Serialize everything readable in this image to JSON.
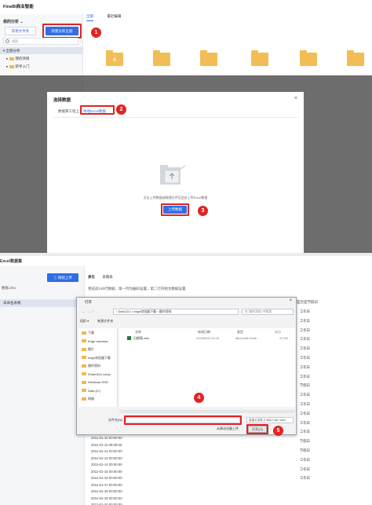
{
  "top": {
    "app_title": "FineBI商业智能",
    "my_analysis": "我的分析",
    "new_folder_label": "新建文件夹",
    "new_theme_label": "新建分析主题",
    "search_placeholder": "搜索",
    "tree": [
      "全部分析",
      "我的项目",
      "新手入门"
    ],
    "tabs": [
      "全部",
      "最近编辑"
    ],
    "folders": [
      "",
      "",
      "",
      "",
      "",
      "",
      "",
      ""
    ],
    "badges": [
      "1",
      "2",
      "3",
      "4",
      "5"
    ]
  },
  "dialog": {
    "title": "选择数据",
    "close": "×",
    "tab_server": "数据库工程上",
    "tab_excel": "本地Excel数据",
    "upload_text": "点击上传数据或拖拽文件至此处上传Excel数据",
    "upload_button": "上传数据"
  },
  "bottom": {
    "title": "Excel数据集",
    "continue_upload": "继续上传",
    "file_sheet": "数据.xlsx",
    "unnamed": "未命名表格",
    "table_tabs": [
      "表名",
      "日期表"
    ],
    "hint": "预览前100行数据，第一列为编码设置，第二行开始为数据设置",
    "right_header": "是否是节假日",
    "rows": [
      "2011-01-10 00:00:00",
      "2011-01-11 00:00:00",
      "2011-01-12 00:00:00",
      "2011-01-13 00:00:00",
      "2011-01-14 00:00:00",
      "2011-01-15 00:00:00",
      "2011-01-16 00:00:00",
      "2011-01-17 00:00:00",
      "2011-01-18 00:00:00",
      "2011-01-19 00:00:00",
      "2011-01-20 00:00:00"
    ],
    "right_vals": [
      "工作日",
      "工作日",
      "工作日",
      "工作日",
      "工作日",
      "工作日",
      "工作日",
      "工作日",
      "节假日",
      "工作日",
      "工作日",
      "工作日",
      "工作日",
      "工作日",
      "节假日",
      "节假日",
      "工作日",
      "工作日",
      "工作日"
    ]
  },
  "file_dialog": {
    "title": "打开",
    "close": "×",
    "nav": "←  →  ↑",
    "address": "› Data (D:) › edge浏览器下载 › 操作资料",
    "search": "在 操作资料 中搜索",
    "toolbar_org": "组织 ▾",
    "toolbar_new": "新建文件夹",
    "sidebar": [
      "下载",
      "Edge downloa",
      "图片",
      "edge浏览器下载",
      "操作资料",
      "ZhanHQ's comp",
      "Windows-SSD",
      "Data (D:)",
      "网络"
    ],
    "columns": [
      "名称",
      "修改日期",
      "类型",
      "大小"
    ],
    "file": {
      "name": "日期表.xlsx",
      "date": "2024/5/25 14:03",
      "type": "Microsoft Excel ...",
      "size": "47 KB"
    },
    "filename_label": "文件名(N):",
    "filter": "自定义文件 (*.xlsx;*.xls;*.csv)",
    "upload_phone": "从移动设备上传",
    "open_button": "打开(O)",
    "cancel_button": "取消"
  }
}
